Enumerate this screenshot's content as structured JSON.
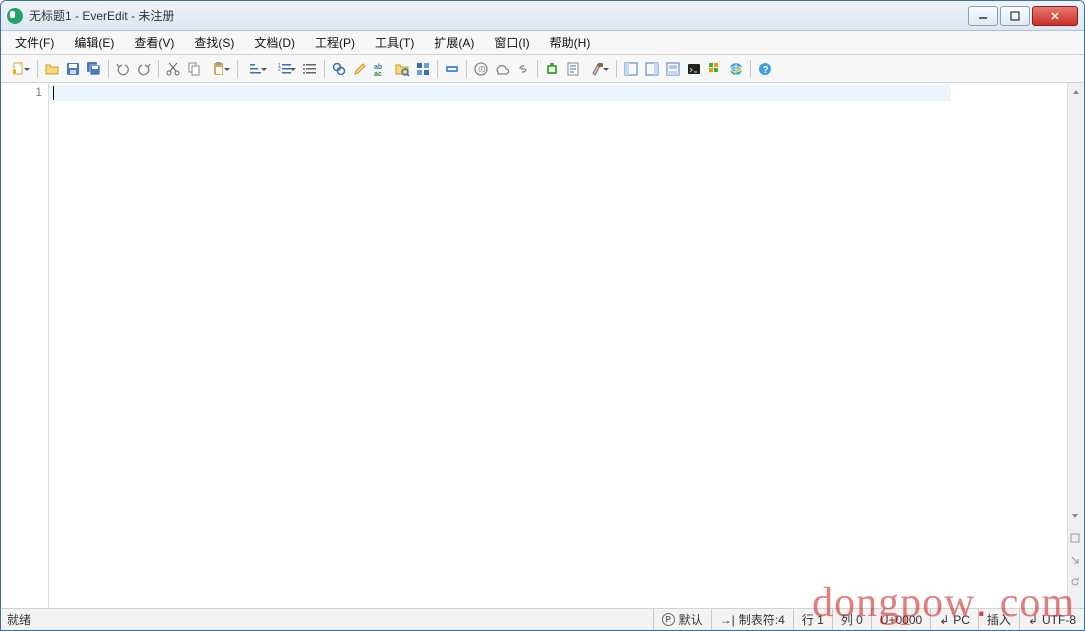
{
  "titlebar": {
    "title": "无标题1 - EverEdit - 未注册"
  },
  "menu": {
    "file": "文件(F)",
    "edit": "编辑(E)",
    "view": "查看(V)",
    "search": "查找(S)",
    "document": "文档(D)",
    "project": "工程(P)",
    "tools": "工具(T)",
    "extensions": "扩展(A)",
    "window": "窗口(I)",
    "help": "帮助(H)"
  },
  "editor": {
    "line_number": "1"
  },
  "status": {
    "ready": "就绪",
    "encoding_icon": "P",
    "default": "默认",
    "tab_label": "制表符:4",
    "line": "行 1",
    "col": "列 0",
    "unicode": "U+0000",
    "lineend_value": "PC",
    "insert": "插入",
    "encoding": "UTF-8"
  },
  "watermark": "dongpow. com"
}
